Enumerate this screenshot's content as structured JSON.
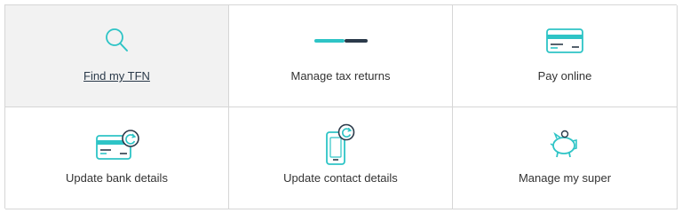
{
  "tiles": [
    {
      "label": "Find my TFN",
      "icon": "search-icon",
      "active": true
    },
    {
      "label": "Manage tax returns",
      "icon": "progress-bar-icon"
    },
    {
      "label": "Pay online",
      "icon": "credit-card-icon"
    },
    {
      "label": "Update bank details",
      "icon": "card-refresh-icon"
    },
    {
      "label": "Update contact details",
      "icon": "mobile-refresh-icon"
    },
    {
      "label": "Manage my super",
      "icon": "piggy-bank-icon"
    }
  ],
  "colors": {
    "accent": "#2ec4c6",
    "dark": "#2b3a4a",
    "border": "#d6d6d6"
  }
}
